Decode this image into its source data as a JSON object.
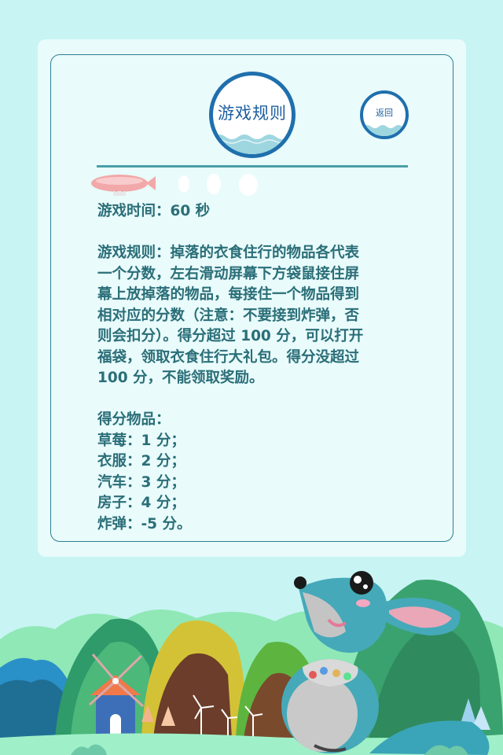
{
  "header": {
    "title": "游戏规则",
    "back_label": "返回"
  },
  "rules": {
    "time_line": "游戏时间：60 秒",
    "rule_lines": [
      "游戏规则：掉落的衣食住行的物品各代表",
      "一个分数，左右滑动屏幕下方袋鼠接住屏",
      "幕上放掉落的物品，每接住一个物品得到",
      "相对应的分数（注意：不要接到炸弹，否",
      "则会扣分）。得分超过 100 分，可以打开",
      "福袋，领取衣食住行大礼包。得分没超过",
      "100 分，不能领取奖励。"
    ],
    "items_heading": "得分物品：",
    "items": [
      "草莓：1 分；",
      "衣服：2 分；",
      "汽车：3 分；",
      "房子：4 分；",
      "炸弹：-5 分。"
    ]
  },
  "colors": {
    "background": "#c8f4f4",
    "card": "#e9fbfb",
    "border": "#2f7f92",
    "text": "#2a6e78",
    "badge_ring": "#1f6fad",
    "badge_wave": "#9ed6e0"
  },
  "icons": {
    "blimp": "blimp-icon",
    "kangaroo": "kangaroo-illustration",
    "windmill": "windmill-icon"
  }
}
